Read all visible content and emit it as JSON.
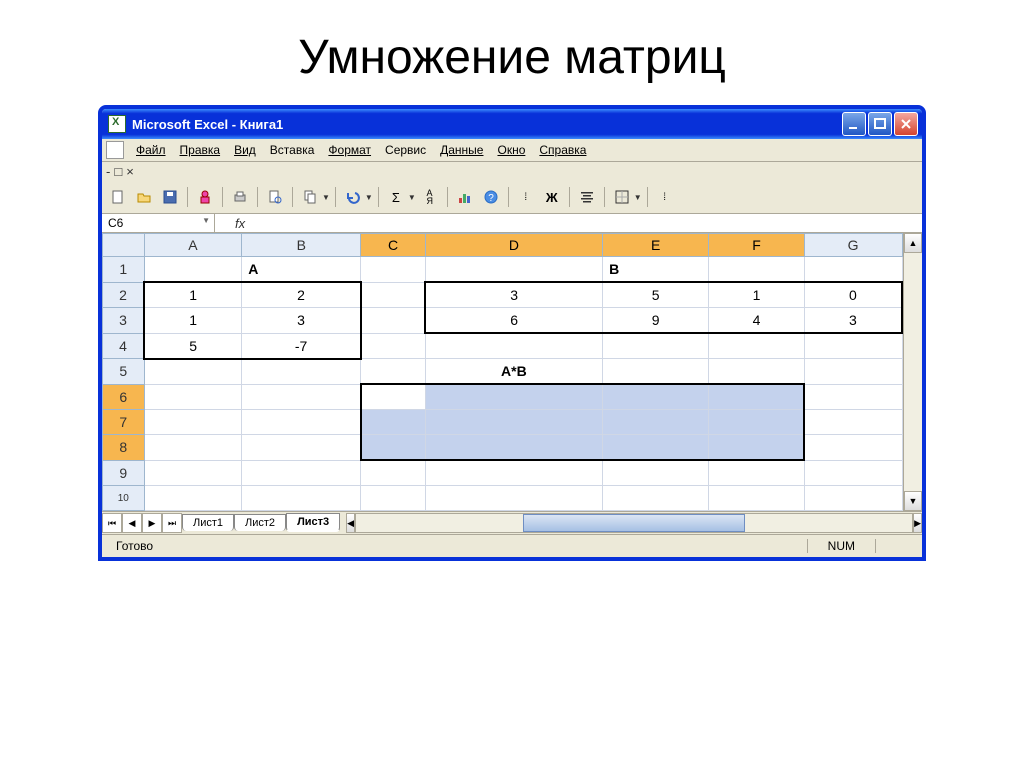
{
  "slide": {
    "title": "Умножение матриц"
  },
  "window": {
    "title": "Microsoft Excel - Книга1"
  },
  "menu": {
    "file": "Файл",
    "edit": "Правка",
    "view": "Вид",
    "insert": "Вставка",
    "format": "Формат",
    "tools": "Сервис",
    "data": "Данные",
    "window_m": "Окно",
    "help": "Справка"
  },
  "toolbar": {
    "bold": "Ж",
    "sigma": "Σ",
    "sort": "А↓Я"
  },
  "namebox": "C6",
  "fx": "fx",
  "columns": [
    "A",
    "B",
    "C",
    "D",
    "E",
    "F",
    "G"
  ],
  "rows": [
    "1",
    "2",
    "3",
    "4",
    "5",
    "6",
    "7",
    "8",
    "9",
    "10"
  ],
  "labels": {
    "A": "A",
    "B": "B",
    "AB": "A*B"
  },
  "matA": {
    "r1": {
      "c1": "1",
      "c2": "2"
    },
    "r2": {
      "c1": "1",
      "c2": "3"
    },
    "r3": {
      "c1": "5",
      "c2": "-7"
    }
  },
  "matB": {
    "r1": {
      "c1": "3",
      "c2": "5",
      "c3": "1",
      "c4": "0"
    },
    "r2": {
      "c1": "6",
      "c2": "9",
      "c3": "4",
      "c4": "3"
    }
  },
  "tabs": {
    "s1": "Лист1",
    "s2": "Лист2",
    "s3": "Лист3"
  },
  "status": {
    "ready": "Готово",
    "num": "NUM"
  },
  "chart_data": null
}
